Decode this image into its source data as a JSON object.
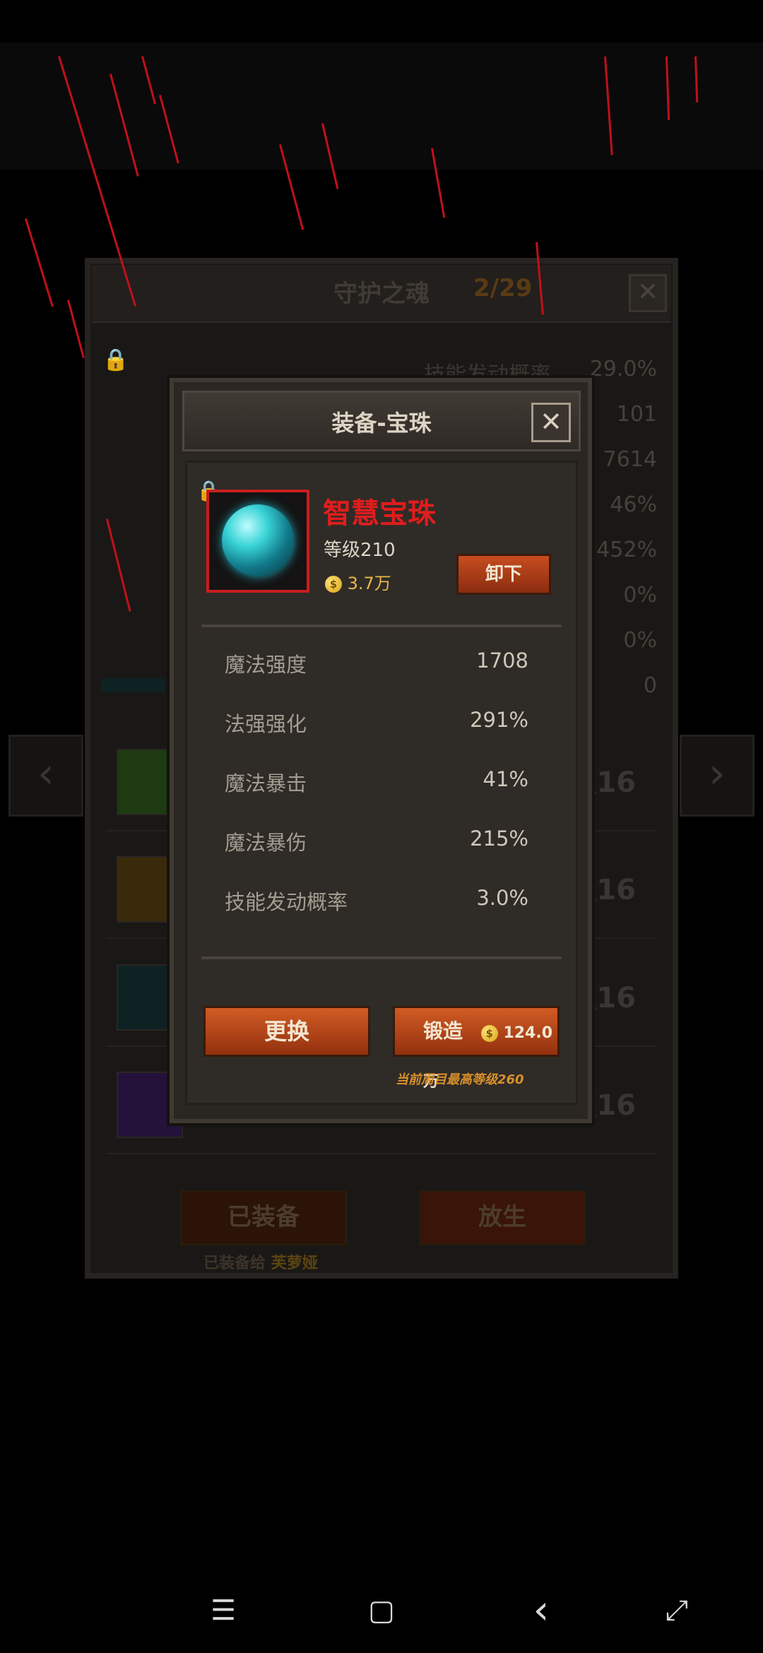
{
  "background": {
    "panel_title": "守护之魂",
    "panel_count": "2/29",
    "close_glyph": "✕",
    "lock_icon": "lock-icon",
    "stats": [
      {
        "label": "技能发动概率",
        "value": "29.0%"
      },
      {
        "label": "",
        "value": "101"
      },
      {
        "label": "",
        "value": "7614"
      },
      {
        "label": "",
        "value": "46%"
      },
      {
        "label": "",
        "value": "452%"
      },
      {
        "label": "",
        "value": "0%"
      },
      {
        "label": "",
        "value": "0%"
      },
      {
        "label": "",
        "value": "0"
      }
    ],
    "rows": [
      {
        "level": "级16"
      },
      {
        "level": "级16"
      },
      {
        "level": "级16"
      },
      {
        "level": "级16"
      }
    ],
    "prev_glyph": "‹",
    "next_glyph": "›",
    "equipped_button": "已装备",
    "release_button": "放生",
    "equipped_to_prefix": "已装备给",
    "equipped_to_name": "芙萝娅"
  },
  "dialog": {
    "title": "装备-宝珠",
    "close_glyph": "✕",
    "item": {
      "name": "智慧宝珠",
      "level": "等级210",
      "price": "3.7万",
      "icon": "orb-icon",
      "name_color": "#e01d1d"
    },
    "unequip_button": "卸下",
    "stats": [
      {
        "label": "魔法强度",
        "value": "1708"
      },
      {
        "label": "法强强化",
        "value": "291%"
      },
      {
        "label": "魔法暴击",
        "value": "41%"
      },
      {
        "label": "魔法暴伤",
        "value": "215%"
      },
      {
        "label": "技能发动概率",
        "value": "3.0%"
      }
    ],
    "swap_button": "更换",
    "forge_button": "锻造",
    "forge_cost": "124.0万",
    "max_level_note": "当前周目最高等级260",
    "coin_glyph": "$"
  },
  "navbar": {
    "menu_glyph": "☰",
    "home_glyph": "▢",
    "back_glyph": "‹",
    "rotate_glyph": "⤢"
  },
  "colors": {
    "accent_button": "#c84d1f",
    "gold": "#e6b84a",
    "rain": "#c0101a"
  }
}
